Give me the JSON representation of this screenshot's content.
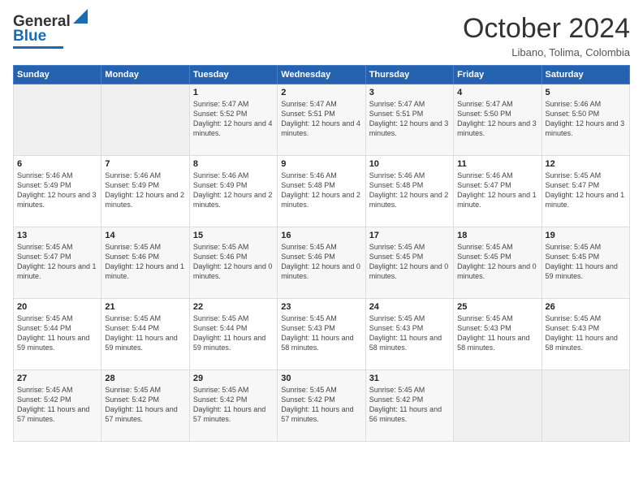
{
  "logo": {
    "line1": "General",
    "line2": "Blue"
  },
  "header": {
    "title": "October 2024",
    "location": "Libano, Tolima, Colombia"
  },
  "weekdays": [
    "Sunday",
    "Monday",
    "Tuesday",
    "Wednesday",
    "Thursday",
    "Friday",
    "Saturday"
  ],
  "weeks": [
    [
      {
        "day": "",
        "sunrise": "",
        "sunset": "",
        "daylight": ""
      },
      {
        "day": "",
        "sunrise": "",
        "sunset": "",
        "daylight": ""
      },
      {
        "day": "1",
        "sunrise": "Sunrise: 5:47 AM",
        "sunset": "Sunset: 5:52 PM",
        "daylight": "Daylight: 12 hours and 4 minutes."
      },
      {
        "day": "2",
        "sunrise": "Sunrise: 5:47 AM",
        "sunset": "Sunset: 5:51 PM",
        "daylight": "Daylight: 12 hours and 4 minutes."
      },
      {
        "day": "3",
        "sunrise": "Sunrise: 5:47 AM",
        "sunset": "Sunset: 5:51 PM",
        "daylight": "Daylight: 12 hours and 3 minutes."
      },
      {
        "day": "4",
        "sunrise": "Sunrise: 5:47 AM",
        "sunset": "Sunset: 5:50 PM",
        "daylight": "Daylight: 12 hours and 3 minutes."
      },
      {
        "day": "5",
        "sunrise": "Sunrise: 5:46 AM",
        "sunset": "Sunset: 5:50 PM",
        "daylight": "Daylight: 12 hours and 3 minutes."
      }
    ],
    [
      {
        "day": "6",
        "sunrise": "Sunrise: 5:46 AM",
        "sunset": "Sunset: 5:49 PM",
        "daylight": "Daylight: 12 hours and 3 minutes."
      },
      {
        "day": "7",
        "sunrise": "Sunrise: 5:46 AM",
        "sunset": "Sunset: 5:49 PM",
        "daylight": "Daylight: 12 hours and 2 minutes."
      },
      {
        "day": "8",
        "sunrise": "Sunrise: 5:46 AM",
        "sunset": "Sunset: 5:49 PM",
        "daylight": "Daylight: 12 hours and 2 minutes."
      },
      {
        "day": "9",
        "sunrise": "Sunrise: 5:46 AM",
        "sunset": "Sunset: 5:48 PM",
        "daylight": "Daylight: 12 hours and 2 minutes."
      },
      {
        "day": "10",
        "sunrise": "Sunrise: 5:46 AM",
        "sunset": "Sunset: 5:48 PM",
        "daylight": "Daylight: 12 hours and 2 minutes."
      },
      {
        "day": "11",
        "sunrise": "Sunrise: 5:46 AM",
        "sunset": "Sunset: 5:47 PM",
        "daylight": "Daylight: 12 hours and 1 minute."
      },
      {
        "day": "12",
        "sunrise": "Sunrise: 5:45 AM",
        "sunset": "Sunset: 5:47 PM",
        "daylight": "Daylight: 12 hours and 1 minute."
      }
    ],
    [
      {
        "day": "13",
        "sunrise": "Sunrise: 5:45 AM",
        "sunset": "Sunset: 5:47 PM",
        "daylight": "Daylight: 12 hours and 1 minute."
      },
      {
        "day": "14",
        "sunrise": "Sunrise: 5:45 AM",
        "sunset": "Sunset: 5:46 PM",
        "daylight": "Daylight: 12 hours and 1 minute."
      },
      {
        "day": "15",
        "sunrise": "Sunrise: 5:45 AM",
        "sunset": "Sunset: 5:46 PM",
        "daylight": "Daylight: 12 hours and 0 minutes."
      },
      {
        "day": "16",
        "sunrise": "Sunrise: 5:45 AM",
        "sunset": "Sunset: 5:46 PM",
        "daylight": "Daylight: 12 hours and 0 minutes."
      },
      {
        "day": "17",
        "sunrise": "Sunrise: 5:45 AM",
        "sunset": "Sunset: 5:45 PM",
        "daylight": "Daylight: 12 hours and 0 minutes."
      },
      {
        "day": "18",
        "sunrise": "Sunrise: 5:45 AM",
        "sunset": "Sunset: 5:45 PM",
        "daylight": "Daylight: 12 hours and 0 minutes."
      },
      {
        "day": "19",
        "sunrise": "Sunrise: 5:45 AM",
        "sunset": "Sunset: 5:45 PM",
        "daylight": "Daylight: 11 hours and 59 minutes."
      }
    ],
    [
      {
        "day": "20",
        "sunrise": "Sunrise: 5:45 AM",
        "sunset": "Sunset: 5:44 PM",
        "daylight": "Daylight: 11 hours and 59 minutes."
      },
      {
        "day": "21",
        "sunrise": "Sunrise: 5:45 AM",
        "sunset": "Sunset: 5:44 PM",
        "daylight": "Daylight: 11 hours and 59 minutes."
      },
      {
        "day": "22",
        "sunrise": "Sunrise: 5:45 AM",
        "sunset": "Sunset: 5:44 PM",
        "daylight": "Daylight: 11 hours and 59 minutes."
      },
      {
        "day": "23",
        "sunrise": "Sunrise: 5:45 AM",
        "sunset": "Sunset: 5:43 PM",
        "daylight": "Daylight: 11 hours and 58 minutes."
      },
      {
        "day": "24",
        "sunrise": "Sunrise: 5:45 AM",
        "sunset": "Sunset: 5:43 PM",
        "daylight": "Daylight: 11 hours and 58 minutes."
      },
      {
        "day": "25",
        "sunrise": "Sunrise: 5:45 AM",
        "sunset": "Sunset: 5:43 PM",
        "daylight": "Daylight: 11 hours and 58 minutes."
      },
      {
        "day": "26",
        "sunrise": "Sunrise: 5:45 AM",
        "sunset": "Sunset: 5:43 PM",
        "daylight": "Daylight: 11 hours and 58 minutes."
      }
    ],
    [
      {
        "day": "27",
        "sunrise": "Sunrise: 5:45 AM",
        "sunset": "Sunset: 5:42 PM",
        "daylight": "Daylight: 11 hours and 57 minutes."
      },
      {
        "day": "28",
        "sunrise": "Sunrise: 5:45 AM",
        "sunset": "Sunset: 5:42 PM",
        "daylight": "Daylight: 11 hours and 57 minutes."
      },
      {
        "day": "29",
        "sunrise": "Sunrise: 5:45 AM",
        "sunset": "Sunset: 5:42 PM",
        "daylight": "Daylight: 11 hours and 57 minutes."
      },
      {
        "day": "30",
        "sunrise": "Sunrise: 5:45 AM",
        "sunset": "Sunset: 5:42 PM",
        "daylight": "Daylight: 11 hours and 57 minutes."
      },
      {
        "day": "31",
        "sunrise": "Sunrise: 5:45 AM",
        "sunset": "Sunset: 5:42 PM",
        "daylight": "Daylight: 11 hours and 56 minutes."
      },
      {
        "day": "",
        "sunrise": "",
        "sunset": "",
        "daylight": ""
      },
      {
        "day": "",
        "sunrise": "",
        "sunset": "",
        "daylight": ""
      }
    ]
  ]
}
